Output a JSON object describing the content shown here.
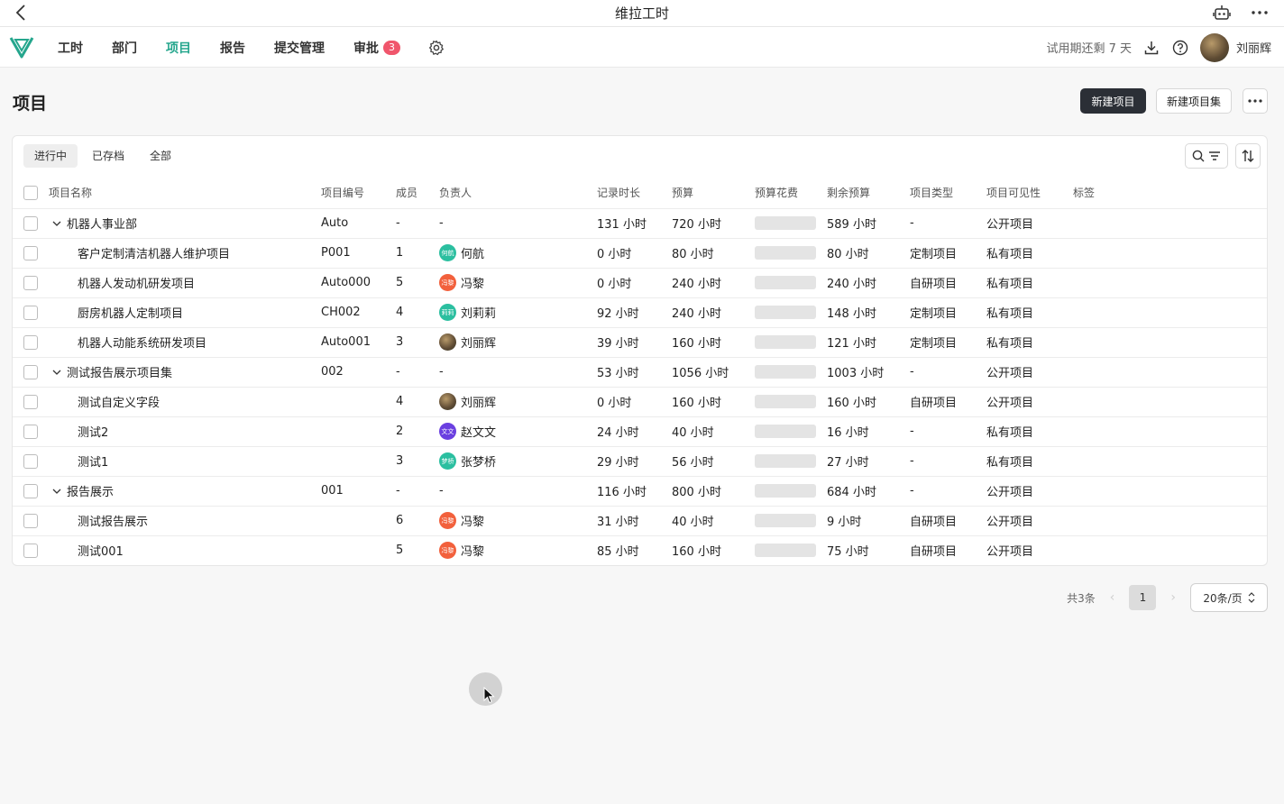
{
  "window": {
    "title": "维拉工时"
  },
  "nav": {
    "items": [
      {
        "label": "工时",
        "active": false
      },
      {
        "label": "部门",
        "active": false
      },
      {
        "label": "项目",
        "active": true
      },
      {
        "label": "报告",
        "active": false
      },
      {
        "label": "提交管理",
        "active": false
      },
      {
        "label": "审批",
        "active": false,
        "badge": "3"
      }
    ],
    "trial_text": "试用期还剩 7 天",
    "username": "刘丽辉"
  },
  "page": {
    "title": "项目",
    "new_project_label": "新建项目",
    "new_project_set_label": "新建项目集"
  },
  "tabs": [
    {
      "label": "进行中",
      "active": true
    },
    {
      "label": "已存档",
      "active": false
    },
    {
      "label": "全部",
      "active": false
    }
  ],
  "table": {
    "headers": [
      "项目名称",
      "项目编号",
      "成员",
      "负责人",
      "记录时长",
      "预算",
      "预算花费",
      "剩余预算",
      "项目类型",
      "项目可见性",
      "标签"
    ],
    "rows": [
      {
        "group": true,
        "name": "机器人事业部",
        "code": "Auto",
        "members": "-",
        "owner": "-",
        "logged": "131 小时",
        "budget": "720 小时",
        "spent": 0.18,
        "remaining": "589 小时",
        "type": "-",
        "visibility": "公开项目"
      },
      {
        "group": false,
        "name": "客户定制清洁机器人维护项目",
        "code": "P001",
        "members": "1",
        "owner": "何航",
        "owner_avatar_text": "何航",
        "owner_color": "#2bbfa0",
        "logged": "0 小时",
        "budget": "80 小时",
        "spent": 0.0,
        "remaining": "80 小时",
        "type": "定制项目",
        "visibility": "私有项目"
      },
      {
        "group": false,
        "name": "机器人发动机研发项目",
        "code": "Auto000",
        "members": "5",
        "owner": "冯黎",
        "owner_avatar_text": "冯黎",
        "owner_color": "#f2603c",
        "logged": "0 小时",
        "budget": "240 小时",
        "spent": 0.0,
        "remaining": "240 小时",
        "type": "自研项目",
        "visibility": "私有项目"
      },
      {
        "group": false,
        "name": "厨房机器人定制项目",
        "code": "CH002",
        "members": "4",
        "owner": "刘莉莉",
        "owner_avatar_text": "莉莉",
        "owner_color": "#2bbfa0",
        "logged": "92 小时",
        "budget": "240 小时",
        "spent": 0.38,
        "remaining": "148 小时",
        "type": "定制项目",
        "visibility": "私有项目"
      },
      {
        "group": false,
        "name": "机器人动能系统研发项目",
        "code": "Auto001",
        "members": "3",
        "owner": "刘丽辉",
        "owner_avatar_text": "",
        "owner_color": "#7a6a4c",
        "logged": "39 小时",
        "budget": "160 小时",
        "spent": 0.24,
        "remaining": "121 小时",
        "type": "定制项目",
        "visibility": "私有项目"
      },
      {
        "group": true,
        "name": "测试报告展示项目集",
        "code": "002",
        "members": "-",
        "owner": "-",
        "logged": "53 小时",
        "budget": "1056 小时",
        "spent": 0.05,
        "remaining": "1003 小时",
        "type": "-",
        "visibility": "公开项目"
      },
      {
        "group": false,
        "name": "测试自定义字段",
        "code": "",
        "members": "4",
        "owner": "刘丽辉",
        "owner_avatar_text": "",
        "owner_color": "#7a6a4c",
        "logged": "0 小时",
        "budget": "160 小时",
        "spent": 0.0,
        "remaining": "160 小时",
        "type": "自研项目",
        "visibility": "公开项目"
      },
      {
        "group": false,
        "name": "测试2",
        "code": "",
        "members": "2",
        "owner": "赵文文",
        "owner_avatar_text": "文文",
        "owner_color": "#6a3fe0",
        "logged": "24 小时",
        "budget": "40 小时",
        "spent": 0.6,
        "remaining": "16 小时",
        "type": "-",
        "visibility": "私有项目"
      },
      {
        "group": false,
        "name": "测试1",
        "code": "",
        "members": "3",
        "owner": "张梦桥",
        "owner_avatar_text": "梦桥",
        "owner_color": "#2bbfa0",
        "logged": "29 小时",
        "budget": "56 小时",
        "spent": 0.52,
        "remaining": "27 小时",
        "type": "-",
        "visibility": "私有项目"
      },
      {
        "group": true,
        "name": "报告展示",
        "code": "001",
        "members": "-",
        "owner": "-",
        "logged": "116 小时",
        "budget": "800 小时",
        "spent": 0.15,
        "remaining": "684 小时",
        "type": "-",
        "visibility": "公开项目"
      },
      {
        "group": false,
        "name": "测试报告展示",
        "code": "",
        "members": "6",
        "owner": "冯黎",
        "owner_avatar_text": "冯黎",
        "owner_color": "#f2603c",
        "logged": "31 小时",
        "budget": "40 小时",
        "spent": 0.78,
        "remaining": "9 小时",
        "type": "自研项目",
        "visibility": "公开项目"
      },
      {
        "group": false,
        "name": "测试001",
        "code": "",
        "members": "5",
        "owner": "冯黎",
        "owner_avatar_text": "冯黎",
        "owner_color": "#f2603c",
        "logged": "85 小时",
        "budget": "160 小时",
        "spent": 0.53,
        "remaining": "75 小时",
        "type": "自研项目",
        "visibility": "公开项目"
      }
    ]
  },
  "pagination": {
    "total_text": "共3条",
    "current_page": "1",
    "page_size_label": "20条/页"
  }
}
